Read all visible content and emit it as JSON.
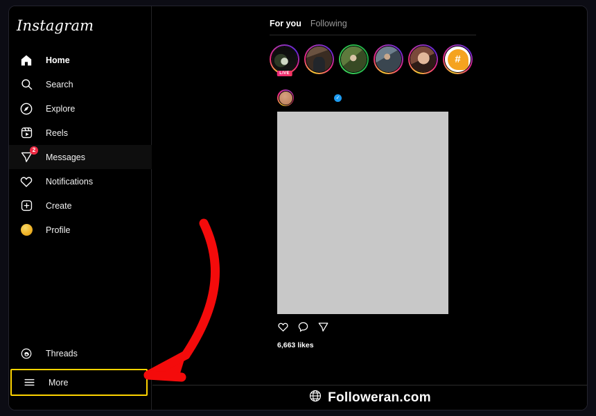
{
  "app": {
    "brand": "Instagram"
  },
  "sidebar": {
    "items": [
      {
        "label": "Home",
        "icon": "home-icon",
        "active": true,
        "badge": null
      },
      {
        "label": "Search",
        "icon": "search-icon",
        "active": false,
        "badge": null
      },
      {
        "label": "Explore",
        "icon": "compass-icon",
        "active": false,
        "badge": null
      },
      {
        "label": "Reels",
        "icon": "reels-icon",
        "active": false,
        "badge": null
      },
      {
        "label": "Messages",
        "icon": "paper-plane-icon",
        "active": false,
        "badge": "2"
      },
      {
        "label": "Notifications",
        "icon": "heart-icon",
        "active": false,
        "badge": null
      },
      {
        "label": "Create",
        "icon": "plus-square-icon",
        "active": false,
        "badge": null
      },
      {
        "label": "Profile",
        "icon": "avatar-icon",
        "active": false,
        "badge": null
      }
    ],
    "bottom": [
      {
        "label": "Threads",
        "icon": "threads-icon"
      },
      {
        "label": "More",
        "icon": "hamburger-icon"
      }
    ],
    "highlight_color": "#ffd400"
  },
  "feed": {
    "tabs": [
      {
        "label": "For you",
        "active": true
      },
      {
        "label": "Following",
        "active": false
      }
    ],
    "stories": [
      {
        "name": "story-1",
        "live_label": "LIVE",
        "ring": "gradient"
      },
      {
        "name": "story-2",
        "live_label": null,
        "ring": "gradient"
      },
      {
        "name": "story-3",
        "live_label": null,
        "ring": "green"
      },
      {
        "name": "story-4",
        "live_label": null,
        "ring": "gradient"
      },
      {
        "name": "story-5",
        "live_label": null,
        "ring": "gradient"
      },
      {
        "name": "story-6",
        "live_label": null,
        "ring": "gradient",
        "icon": "hashtag-icon"
      }
    ],
    "post": {
      "username": "",
      "verified_glyph": "✓",
      "likes": "6,663 likes",
      "actions": [
        {
          "name": "like-button",
          "icon": "heart-icon"
        },
        {
          "name": "comment-button",
          "icon": "comment-icon"
        },
        {
          "name": "share-button",
          "icon": "paper-plane-icon"
        }
      ]
    }
  },
  "footer": {
    "site": "Followeran.com",
    "icon": "globe-icon"
  },
  "annotation": {
    "arrow_color": "#f40b0b",
    "points_to": "More"
  }
}
